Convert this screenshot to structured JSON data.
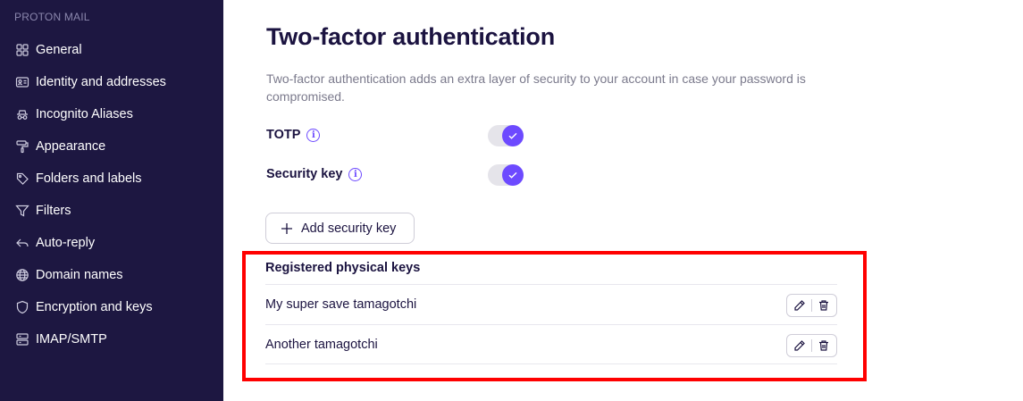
{
  "sidebar": {
    "brand": "PROTON MAIL",
    "items": [
      {
        "label": "General",
        "icon": "grid-icon"
      },
      {
        "label": "Identity and addresses",
        "icon": "id-card-icon"
      },
      {
        "label": "Incognito Aliases",
        "icon": "incognito-icon"
      },
      {
        "label": "Appearance",
        "icon": "paint-roller-icon"
      },
      {
        "label": "Folders and labels",
        "icon": "tag-icon"
      },
      {
        "label": "Filters",
        "icon": "filter-icon"
      },
      {
        "label": "Auto-reply",
        "icon": "reply-icon"
      },
      {
        "label": "Domain names",
        "icon": "globe-icon"
      },
      {
        "label": "Encryption and keys",
        "icon": "shield-icon"
      },
      {
        "label": "IMAP/SMTP",
        "icon": "servers-icon"
      }
    ]
  },
  "main": {
    "title": "Two-factor authentication",
    "description": "Two-factor authentication adds an extra layer of security to your account in case your password is compromised.",
    "settings": [
      {
        "label": "TOTP",
        "enabled": true
      },
      {
        "label": "Security key",
        "enabled": true
      }
    ],
    "add_button_label": "Add security key",
    "keys_section_title": "Registered physical keys",
    "keys": [
      {
        "name": "My super save tamagotchi"
      },
      {
        "name": "Another tamagotchi"
      }
    ]
  },
  "colors": {
    "sidebar_bg": "#1d1741",
    "accent": "#6d4aff",
    "highlight": "#ff0000"
  }
}
